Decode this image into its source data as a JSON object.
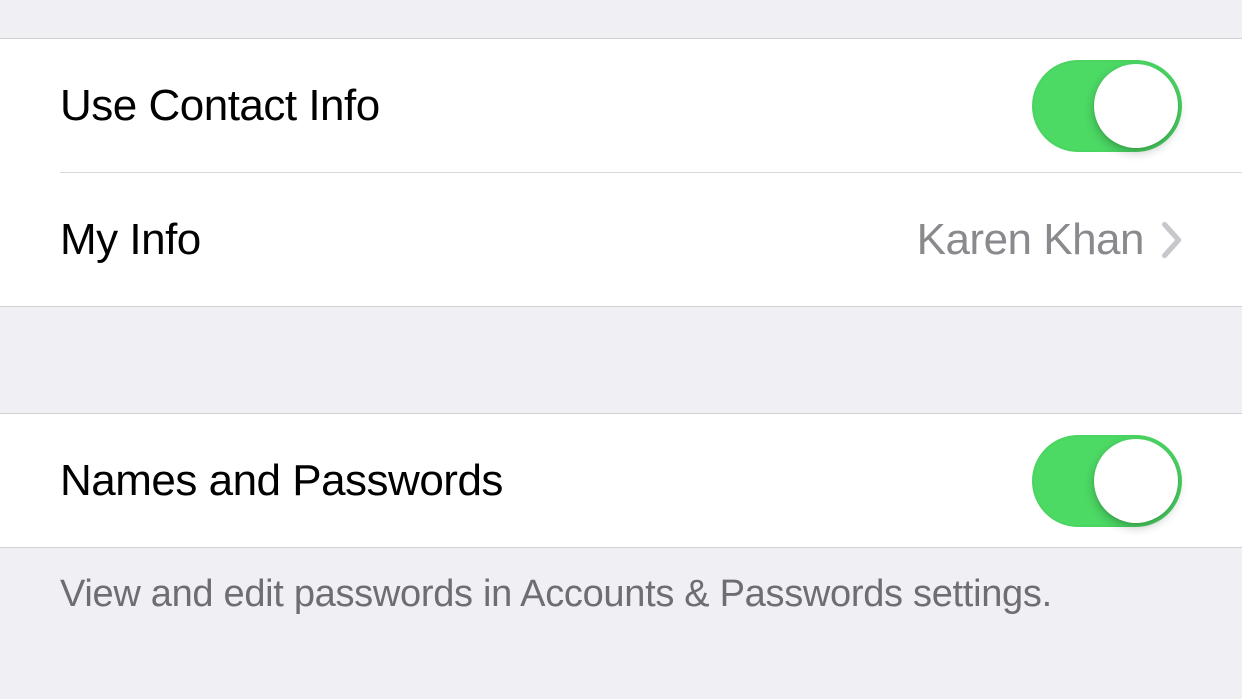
{
  "section1": {
    "useContactInfo": {
      "label": "Use Contact Info",
      "enabled": true
    },
    "myInfo": {
      "label": "My Info",
      "value": "Karen Khan"
    }
  },
  "section2": {
    "namesAndPasswords": {
      "label": "Names and Passwords",
      "enabled": true
    },
    "footer": "View and edit passwords in Accounts & Passwords settings."
  }
}
